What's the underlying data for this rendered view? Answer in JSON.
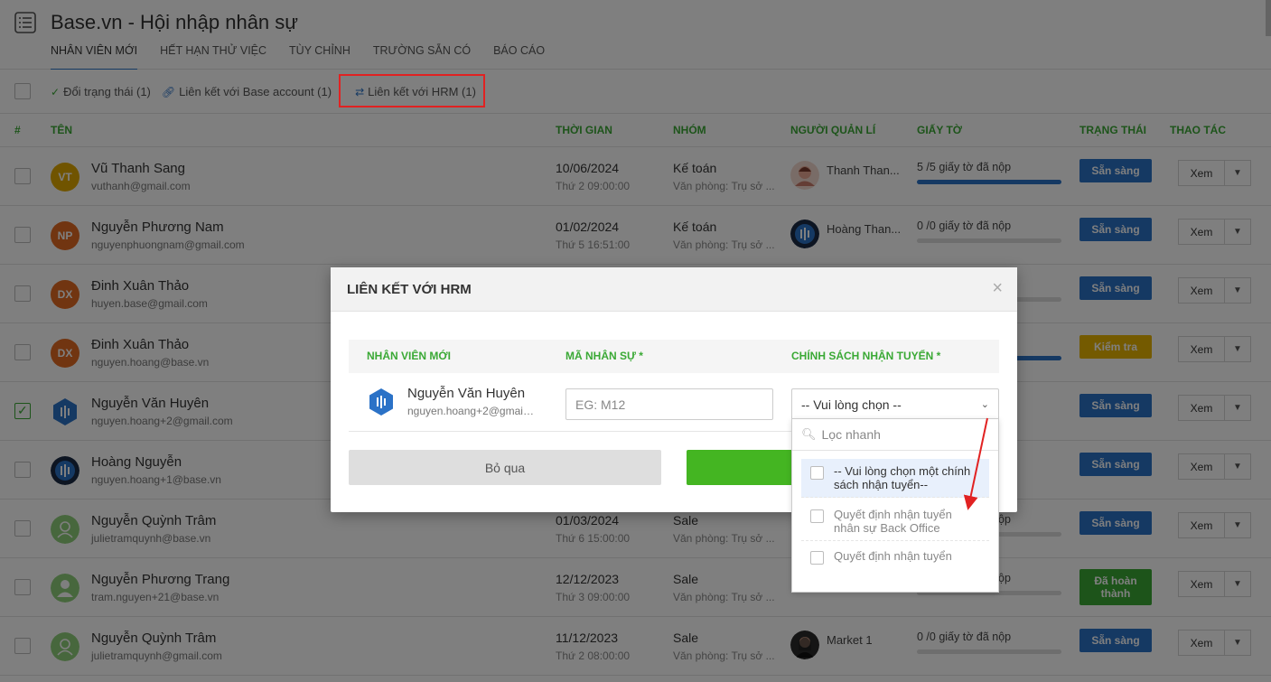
{
  "header": {
    "title": "Base.vn - Hội nhập nhân sự",
    "tabs": [
      "NHÂN VIÊN MỚI",
      "HẾT HẠN THỬ VIỆC",
      "TÙY CHỈNH",
      "TRƯỜNG SẴN CÓ",
      "BÁO CÁO"
    ]
  },
  "toolbar": {
    "change_status": "Đổi trạng thái (1)",
    "link_base": "Liên kết với Base account (1)",
    "link_hrm": "Liên kết với HRM (1)"
  },
  "table": {
    "headers": {
      "num": "#",
      "name": "TÊN",
      "time": "THỜI GIAN",
      "group": "NHÓM",
      "manager": "NGƯỜI QUẢN LÍ",
      "docs": "GIẤY TỜ",
      "status": "TRẠNG THÁI",
      "actions": "THAO TÁC"
    },
    "view_label": "Xem",
    "rows": [
      {
        "initials": "VT",
        "name": "Vũ Thanh Sang",
        "email": "vuthanh@gmail.com",
        "date": "10/06/2024",
        "time": "Thứ 2 09:00:00",
        "group": "Kế toán",
        "office": "Văn phòng: Trụ sở ...",
        "manager": "Thanh Than...",
        "docs": "5 /5 giấy tờ đã nộp",
        "progress": 1.0,
        "status": "Sẵn sàng"
      },
      {
        "initials": "NP",
        "name": "Nguyễn Phương Nam",
        "email": "nguyenphuongnam@gmail.com",
        "date": "01/02/2024",
        "time": "Thứ 5 16:51:00",
        "group": "Kế toán",
        "office": "Văn phòng: Trụ sở ...",
        "manager": "Hoàng Than...",
        "docs": "0 /0 giấy tờ đã nộp",
        "progress": 0,
        "status": "Sẵn sàng"
      },
      {
        "initials": "DX",
        "name": "Đinh Xuân Thảo",
        "email": "huyen.base@gmail.com",
        "status": "Sẵn sàng"
      },
      {
        "initials": "DX",
        "name": "Đinh Xuân Thảo",
        "email": "nguyen.hoang@base.vn",
        "status": "Kiểm tra"
      },
      {
        "initials": "",
        "name": "Nguyễn Văn Huyên",
        "email": "nguyen.hoang+2@gmail.com",
        "status": "Sẵn sàng"
      },
      {
        "initials": "",
        "name": "Hoàng Nguyễn",
        "email": "nguyen.hoang+1@base.vn",
        "status": "Sẵn sàng"
      },
      {
        "initials": "",
        "name": "Nguyễn Quỳnh Trâm",
        "email": "julietramquynh@base.vn",
        "date": "01/03/2024",
        "time": "Thứ 6 15:00:00",
        "group": "Sale",
        "office": "Văn phòng: Trụ sở ...",
        "docs_tail": "ộp",
        "status": "Sẵn sàng"
      },
      {
        "initials": "",
        "name": "Nguyễn Phương Trang",
        "email": "tram.nguyen+21@base.vn",
        "date": "12/12/2023",
        "time": "Thứ 3 09:00:00",
        "group": "Sale",
        "office": "Văn phòng: Trụ sở ...",
        "docs_tail": "ộp",
        "status": "Đã hoàn thành"
      },
      {
        "initials": "",
        "name": "Nguyễn Quỳnh Trâm",
        "email": "julietramquynh@gmail.com",
        "date": "11/12/2023",
        "time": "Thứ 2 08:00:00",
        "group": "Sale",
        "office": "Văn phòng: Trụ sở ...",
        "manager": "Market 1",
        "docs": "0 /0 giấy tờ đã nộp",
        "progress": 0,
        "status": "Sẵn sàng"
      }
    ]
  },
  "modal": {
    "title": "LIÊN KẾT VỚI HRM",
    "col_employee": "NHÂN VIÊN MỚI",
    "col_code": "MÃ NHÂN SỰ *",
    "col_policy": "CHÍNH SÁCH NHẬN TUYỂN *",
    "employee_name": "Nguyễn Văn Huyên",
    "employee_email": "nguyen.hoang+2@gmail.com",
    "code_placeholder": "EG: M12",
    "policy_selected": "-- Vui lòng chọn --",
    "skip_label": "Bỏ qua"
  },
  "dropdown": {
    "search_placeholder": "Lọc nhanh",
    "options": [
      "-- Vui lòng chọn một chính sách nhận tuyển--",
      "Quyết định nhận tuyển nhân sự Back Office",
      "Quyết định nhận tuyển"
    ]
  },
  "colors": {
    "accent_green": "#3aa935",
    "ready_blue": "#2b72c7",
    "check_yellow": "#e8b400",
    "done_green": "#3aa935"
  }
}
